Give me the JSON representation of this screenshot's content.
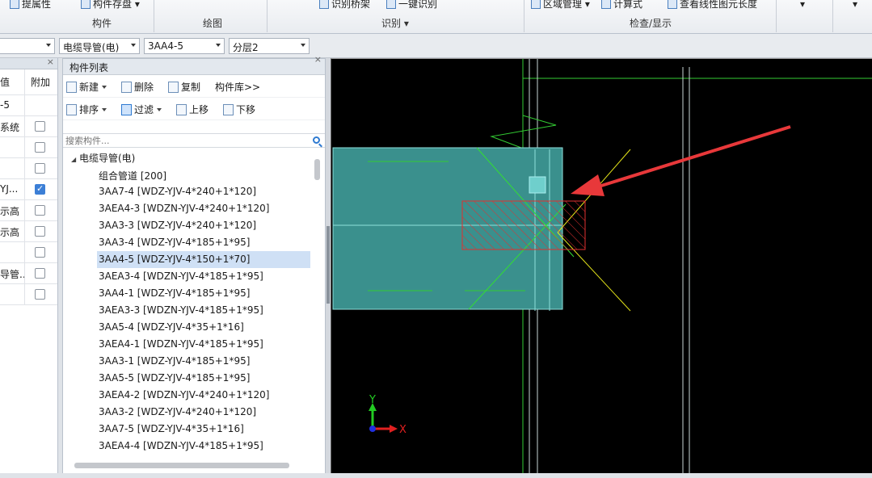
{
  "ribbon": {
    "groups": [
      {
        "label": "构件",
        "items": [
          "提属性",
          "构件存盘"
        ]
      },
      {
        "label": "绘图",
        "items": []
      },
      {
        "label": "识别",
        "items": [
          "识别桥架",
          "一键识别"
        ]
      },
      {
        "label": "检查/显示",
        "items": [
          "区域管理",
          "计算式",
          "查看线性图元长度"
        ]
      }
    ]
  },
  "selectors": {
    "first": "",
    "type": "电缆导管(电)",
    "component": "3AA4-5",
    "layer": "分层2"
  },
  "left_panel": {
    "headers": [
      "值",
      "附加"
    ],
    "rows": [
      {
        "value": "-5",
        "checked": null
      },
      {
        "value": "系统",
        "checked": false
      },
      {
        "value": "",
        "checked": false
      },
      {
        "value": "",
        "checked": false
      },
      {
        "value": "YJ...",
        "checked": true
      },
      {
        "value": "示高",
        "checked": false
      },
      {
        "value": "示高",
        "checked": false
      },
      {
        "value": "",
        "checked": false
      },
      {
        "value": "导管...",
        "checked": false
      },
      {
        "value": "",
        "checked": false
      }
    ]
  },
  "component_list": {
    "title": "构件列表",
    "toolbar_row1": [
      "新建",
      "删除",
      "复制",
      "构件库>>"
    ],
    "toolbar_row2": [
      "排序",
      "过滤",
      "上移",
      "下移"
    ],
    "search_placeholder": "搜索构件...",
    "root": "电缆导管(电)",
    "items": [
      "组合管道 [200]",
      "3AA7-4 [WDZ-YJV-4*240+1*120]",
      "3AEA4-3 [WDZN-YJV-4*240+1*120]",
      "3AA3-3 [WDZ-YJV-4*240+1*120]",
      "3AA3-4 [WDZ-YJV-4*185+1*95]",
      "3AA4-5 [WDZ-YJV-4*150+1*70]",
      "3AEA3-4 [WDZN-YJV-4*185+1*95]",
      "3AA4-1 [WDZ-YJV-4*185+1*95]",
      "3AEA3-3 [WDZN-YJV-4*185+1*95]",
      "3AA5-4 [WDZ-YJV-4*35+1*16]",
      "3AEA4-1 [WDZN-YJV-4*185+1*95]",
      "3AA3-1 [WDZ-YJV-4*185+1*95]",
      "3AA5-5 [WDZ-YJV-4*185+1*95]",
      "3AEA4-2 [WDZN-YJV-4*240+1*120]",
      "3AA3-2 [WDZ-YJV-4*240+1*120]",
      "3AA7-5 [WDZ-YJV-4*35+1*16]",
      "3AEA4-4 [WDZN-YJV-4*185+1*95]"
    ],
    "selected_index": 5
  },
  "canvas": {
    "axis_x_label": "X",
    "axis_y_label": "Y",
    "colors": {
      "background": "#000000",
      "duct": "#2e8f8c",
      "green_line": "#33cc33",
      "yellow_line": "#e6e61a",
      "red_hatch": "#e03030",
      "arrow": "#e8383a"
    }
  }
}
